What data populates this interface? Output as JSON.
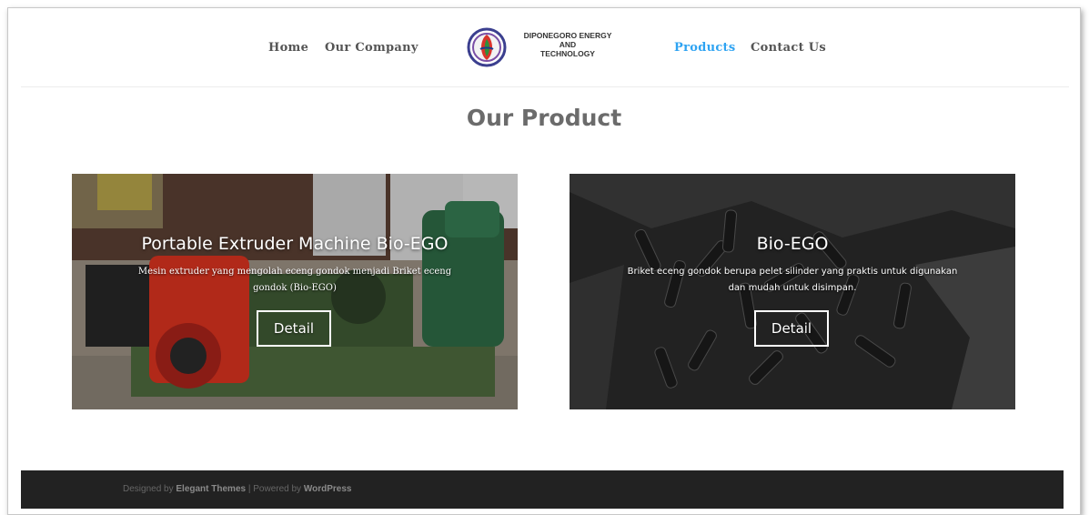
{
  "nav": {
    "items": [
      {
        "label": "Home",
        "active": false
      },
      {
        "label": "Our Company",
        "active": false
      },
      {
        "label": "Products",
        "active": true
      },
      {
        "label": "Contact Us",
        "active": false
      }
    ],
    "logo_lines": [
      "DIPONEGORO ENERGY",
      "AND",
      "TECHNOLOGY"
    ]
  },
  "page_title": "Our Product",
  "products": [
    {
      "title": "Portable Extruder Machine Bio-EGO",
      "description": "Mesin extruder yang mengolah eceng gondok menjadi Briket eceng gondok (Bio-EGO)",
      "button": "Detail"
    },
    {
      "title": "Bio-EGO",
      "description": "Briket eceng gondok berupa pelet silinder yang praktis untuk digunakan dan mudah untuk disimpan.",
      "button": "Detail"
    }
  ],
  "footer": {
    "designed_by": "Designed by",
    "designer": "Elegant Themes",
    "separator": "|",
    "powered_by": "Powered by",
    "platform": "WordPress"
  },
  "colors": {
    "nav_text": "#555555",
    "nav_active": "#2ea3f2",
    "title": "#6b6b6b",
    "footer_bg": "#222222"
  }
}
